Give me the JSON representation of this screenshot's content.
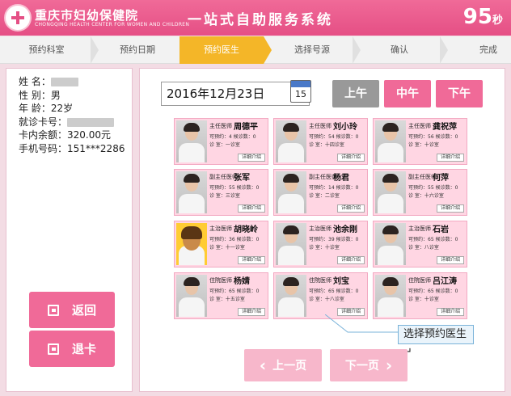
{
  "header": {
    "hospital_name": "重庆市妇幼保健院",
    "hospital_en": "CHONGQING HEALTH CENTER FOR WOMEN AND CHILDREN",
    "system_title": "一站式自助服务系统",
    "countdown_value": "95",
    "countdown_unit": "秒"
  },
  "steps": [
    {
      "label": "预约科室",
      "active": false
    },
    {
      "label": "预约日期",
      "active": false
    },
    {
      "label": "预约医生",
      "active": true
    },
    {
      "label": "选择号源",
      "active": false
    },
    {
      "label": "确认",
      "active": false
    },
    {
      "label": "完成",
      "active": false
    }
  ],
  "patient": {
    "name_label": "姓    名：",
    "gender_label": "性    别：",
    "gender_value": "男",
    "age_label": "年    龄：",
    "age_value": "22岁",
    "card_label": "就诊卡号：",
    "balance_label": "卡内余额：",
    "balance_value": "320.00元",
    "phone_label": "手机号码：",
    "phone_value": "151***2286"
  },
  "left_buttons": {
    "back": "返回",
    "exit_card": "退卡"
  },
  "date": {
    "value": "2016年12月23日",
    "calendar_day": "15"
  },
  "time_slots": [
    {
      "label": "上午",
      "active": false
    },
    {
      "label": "中午",
      "active": true
    },
    {
      "label": "下午",
      "active": true
    }
  ],
  "doctors": [
    {
      "title": "主任医师",
      "name": "周德平",
      "bookable": "4",
      "booked": "0",
      "room": "一诊室"
    },
    {
      "title": "主任医师",
      "name": "刘小玲",
      "bookable": "54",
      "booked": "0",
      "room": "十四诊室"
    },
    {
      "title": "主任医师",
      "name": "龚祝萍",
      "bookable": "56",
      "booked": "0",
      "room": "十诊室"
    },
    {
      "title": "副主任医师",
      "name": "张军",
      "bookable": "55",
      "booked": "0",
      "room": "三诊室"
    },
    {
      "title": "副主任医师",
      "name": "杨君",
      "bookable": "14",
      "booked": "0",
      "room": "二诊室"
    },
    {
      "title": "副主任医师",
      "name": "何萍",
      "bookable": "55",
      "booked": "0",
      "room": "十六诊室"
    },
    {
      "title": "主治医师",
      "name": "胡晓岭",
      "bookable": "36",
      "booked": "0",
      "room": "十一诊室"
    },
    {
      "title": "主治医师",
      "name": "池余刚",
      "bookable": "39",
      "booked": "0",
      "room": "十诊室"
    },
    {
      "title": "主治医师",
      "name": "石岩",
      "bookable": "65",
      "booked": "0",
      "room": "八诊室"
    },
    {
      "title": "住院医师",
      "name": "杨婧",
      "bookable": "65",
      "booked": "0",
      "room": "十五诊室"
    },
    {
      "title": "住院医师",
      "name": "刘宝",
      "bookable": "65",
      "booked": "0",
      "room": "十八诊室"
    },
    {
      "title": "住院医师",
      "name": "吕江涛",
      "bookable": "65",
      "booked": "0",
      "room": "十诊室"
    }
  ],
  "card_labels": {
    "bookable": "可预约：",
    "booked": "候诊数：",
    "room": "诊  室：",
    "detail": "详细介绍"
  },
  "tooltip": "选择预约医生↵",
  "pagination": {
    "prev": "上一页",
    "next": "下一页"
  },
  "colors": {
    "brand_pink": "#f06a98",
    "active_step": "#f4b628",
    "disabled_slot": "#999999"
  }
}
